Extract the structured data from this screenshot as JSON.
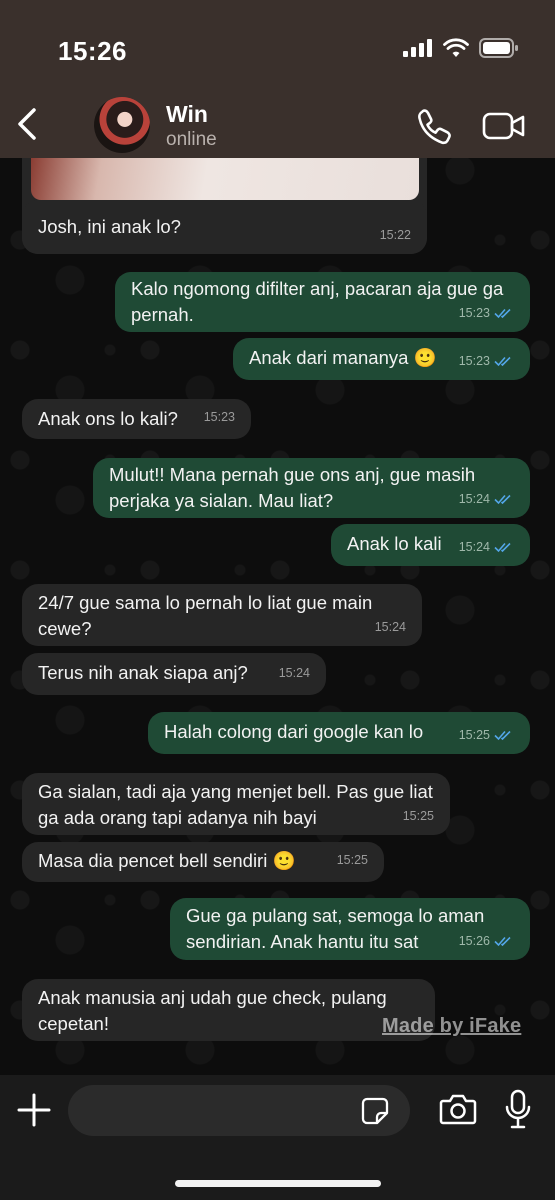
{
  "status_bar": {
    "time": "15:26"
  },
  "header": {
    "contact_name": "Win",
    "contact_status": "online"
  },
  "messages": [
    {
      "dir": "in",
      "text": "Josh, ini anak lo?",
      "time": "15:22"
    },
    {
      "dir": "out",
      "text": "Kalo ngomong difilter anj, pacaran aja gue ga pernah.",
      "time": "15:23"
    },
    {
      "dir": "out",
      "text": "Anak dari mananya 🙂",
      "time": "15:23"
    },
    {
      "dir": "in",
      "text": "Anak ons lo kali?",
      "time": "15:23"
    },
    {
      "dir": "out",
      "text": "Mulut!! Mana pernah gue ons anj, gue masih perjaka ya sialan. Mau liat?",
      "time": "15:24"
    },
    {
      "dir": "out",
      "text": "Anak lo kali",
      "time": "15:24"
    },
    {
      "dir": "in",
      "text": "24/7 gue sama lo pernah lo liat gue main cewe?",
      "time": "15:24"
    },
    {
      "dir": "in",
      "text": "Terus nih anak siapa anj?",
      "time": "15:24"
    },
    {
      "dir": "out",
      "text": "Halah colong dari google kan lo",
      "time": "15:25"
    },
    {
      "dir": "in",
      "text": "Ga sialan, tadi aja yang menjet bell. Pas gue liat ga ada orang tapi adanya nih bayi",
      "time": "15:25"
    },
    {
      "dir": "in",
      "text": "Masa dia pencet bell sendiri 🙂",
      "time": "15:25"
    },
    {
      "dir": "out",
      "text": "Gue ga pulang sat, semoga lo aman sendirian. Anak hantu itu sat",
      "time": "15:26"
    },
    {
      "dir": "in",
      "text": "Anak manusia anj udah gue check, pulang cepetan!",
      "time": ""
    }
  ],
  "watermark": "Made by iFake",
  "composer": {
    "value": "",
    "placeholder": ""
  },
  "icons": {
    "back": "chevron-left-icon",
    "call": "phone-icon",
    "video": "video-camera-icon",
    "plus": "plus-icon",
    "sticker": "sticker-icon",
    "camera": "camera-icon",
    "mic": "microphone-icon"
  },
  "colors": {
    "header_bg": "#3a302c",
    "incoming_bubble": "#262626",
    "outgoing_bubble": "#1f4a35",
    "read_ticks": "#53a6e8"
  }
}
